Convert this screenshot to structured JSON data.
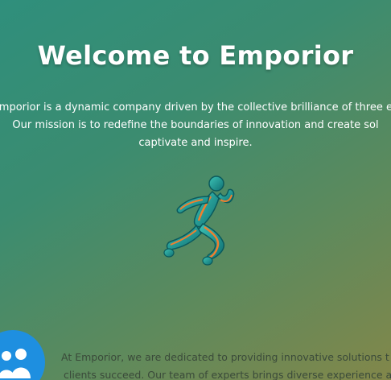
{
  "hero": {
    "title": "Welcome to Emporior",
    "description_lines": [
      "Emporior is a dynamic company driven by the collective brilliance of three ex",
      "Our mission is to redefine the boundaries of innovation and create sol",
      "captivate and inspire."
    ],
    "logo_icon": "running-figure-icon"
  },
  "about": {
    "avatar_icon": "team-people-icon",
    "text_lines": [
      "At Emporior, we are dedicated to providing innovative solutions t",
      "clients succeed. Our team of experts brings diverse experience a"
    ]
  },
  "colors": {
    "background_start": "#2f8f7c",
    "background_end": "#82874a",
    "title_text": "#ffffff",
    "body_text": "#ffffff",
    "about_text": "#3a4a3a",
    "avatar_bg": "#1e8fe0",
    "logo_teal": "#1aa39a",
    "logo_orange": "#f07f2e"
  }
}
